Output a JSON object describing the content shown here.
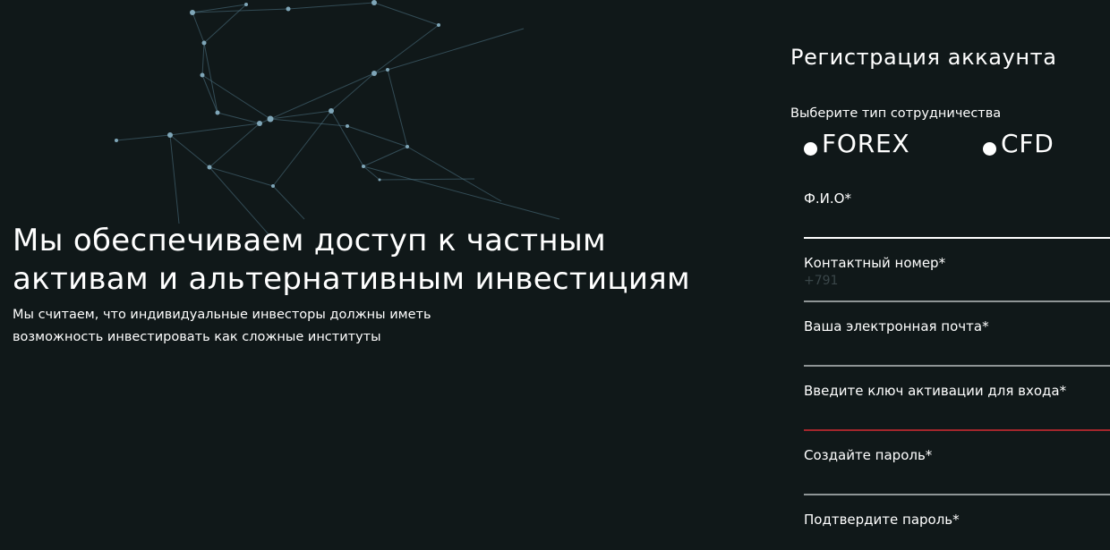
{
  "hero": {
    "title": "Мы обеспечиваем доступ к частным активам и альтернативным инвестициям",
    "description": "Мы считаем, что индивидуальные инвесторы должны иметь возможность инвестировать как сложные институты"
  },
  "registration": {
    "title": "Регистрация аккаунта",
    "cooperation_label": "Выберите тип сотрудничества",
    "options": [
      "FOREX",
      "CFD"
    ],
    "fields": [
      {
        "label": "Ф.И.О*",
        "value": "",
        "placeholder": ""
      },
      {
        "label": "Контактный номер*",
        "value": "",
        "placeholder": "+791"
      },
      {
        "label": "Ваша электронная почта*",
        "value": "",
        "placeholder": ""
      },
      {
        "label": "Введите ключ активации для входа*",
        "value": "",
        "placeholder": ""
      },
      {
        "label": "Создайте пароль*",
        "value": "",
        "placeholder": ""
      },
      {
        "label": "Подтвердите пароль*",
        "value": "",
        "placeholder": ""
      }
    ]
  },
  "colors": {
    "background": "#101819",
    "text": "#ffffff",
    "underline": "#8f9596",
    "error": "#a3262c",
    "network": "#4f7586"
  },
  "icons": {
    "background": "network-graphic-icon",
    "radio": "radio-dot-icon"
  }
}
